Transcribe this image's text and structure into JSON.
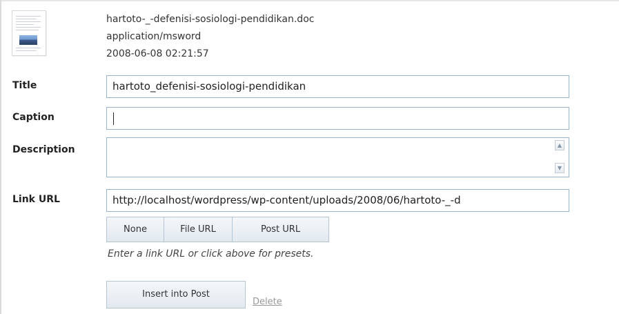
{
  "file": {
    "name": "hartoto-_-defenisi-sosiologi-pendidikan.doc",
    "mime": "application/msword",
    "date": "2008-06-08 02:21:57",
    "thumbnail_icon": "document-thumbnail-icon"
  },
  "form": {
    "title_label": "Title",
    "title_value": "hartoto_defenisi-sosiologi-pendidikan",
    "caption_label": "Caption",
    "caption_value": "",
    "description_label": "Description",
    "description_value": "",
    "link_label": "Link URL",
    "link_value": "http://localhost/wordpress/wp-content/uploads/2008/06/hartoto-_-d",
    "buttons": {
      "none": "None",
      "file_url": "File URL",
      "post_url": "Post URL"
    },
    "hint": "Enter a link URL or click above for presets.",
    "insert": "Insert into Post",
    "delete": "Delete"
  }
}
